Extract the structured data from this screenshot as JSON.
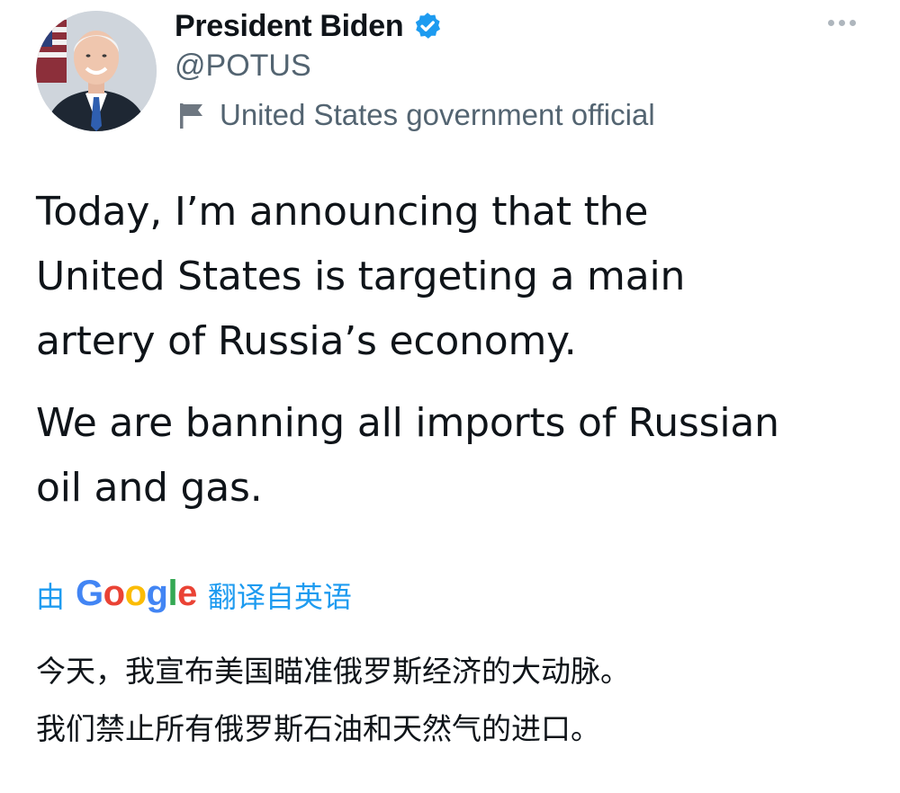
{
  "author": {
    "display_name": "President Biden",
    "handle": "@POTUS",
    "label": "United States government official",
    "avatar_icon": "profile-photo",
    "verified_icon": "verified-badge-icon",
    "verified_color": "#1d9bf0"
  },
  "menu": {
    "more_icon": "more-options-icon"
  },
  "tweet": {
    "paragraph_1": [
      "Today, I’m announcing that the",
      "United States is targeting a main",
      "artery of Russia’s economy."
    ],
    "paragraph_2": [
      "We are banning all imports of Russian",
      "oil and gas."
    ]
  },
  "translation": {
    "prefix": "由",
    "service_logo_text": "Google",
    "suffix": "翻译自英语",
    "link_color": "#1d9bf0",
    "lines": [
      "今天，我宣布美国瞄准俄罗斯经济的大动脉。",
      "我们禁止所有俄罗斯石油和天然气的进口。"
    ]
  }
}
